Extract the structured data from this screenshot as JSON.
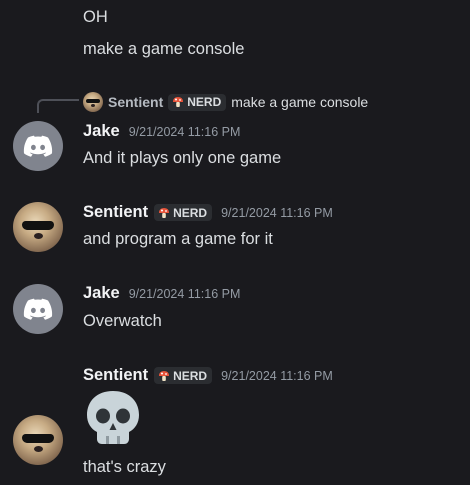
{
  "colors": {
    "background": "#1a1a1e",
    "tag_bg": "#2b2d31",
    "discord_avatar": "#80848e",
    "time": "#949ba4"
  },
  "messages": [
    {
      "text": "OH"
    },
    {
      "text": "make a game console"
    }
  ],
  "reply": {
    "author": "Sentient",
    "tag": "NERD",
    "text": "make a game console"
  },
  "groups": [
    {
      "author": "Jake",
      "time": "9/21/2024 11:16 PM",
      "lines": [
        "And it plays only one game"
      ],
      "avatar": "discord-icon"
    },
    {
      "author": "Sentient",
      "tag": "NERD",
      "time": "9/21/2024 11:16 PM",
      "lines": [
        "and program a game for it"
      ],
      "avatar": "dog-avatar"
    },
    {
      "author": "Jake",
      "time": "9/21/2024 11:16 PM",
      "lines": [
        "Overwatch"
      ],
      "avatar": "discord-icon"
    },
    {
      "author": "Sentient",
      "tag": "NERD",
      "time": "9/21/2024 11:16 PM",
      "lines": [
        "that's crazy"
      ],
      "avatar": "dog-avatar",
      "emoji": "skull-emoji"
    }
  ]
}
